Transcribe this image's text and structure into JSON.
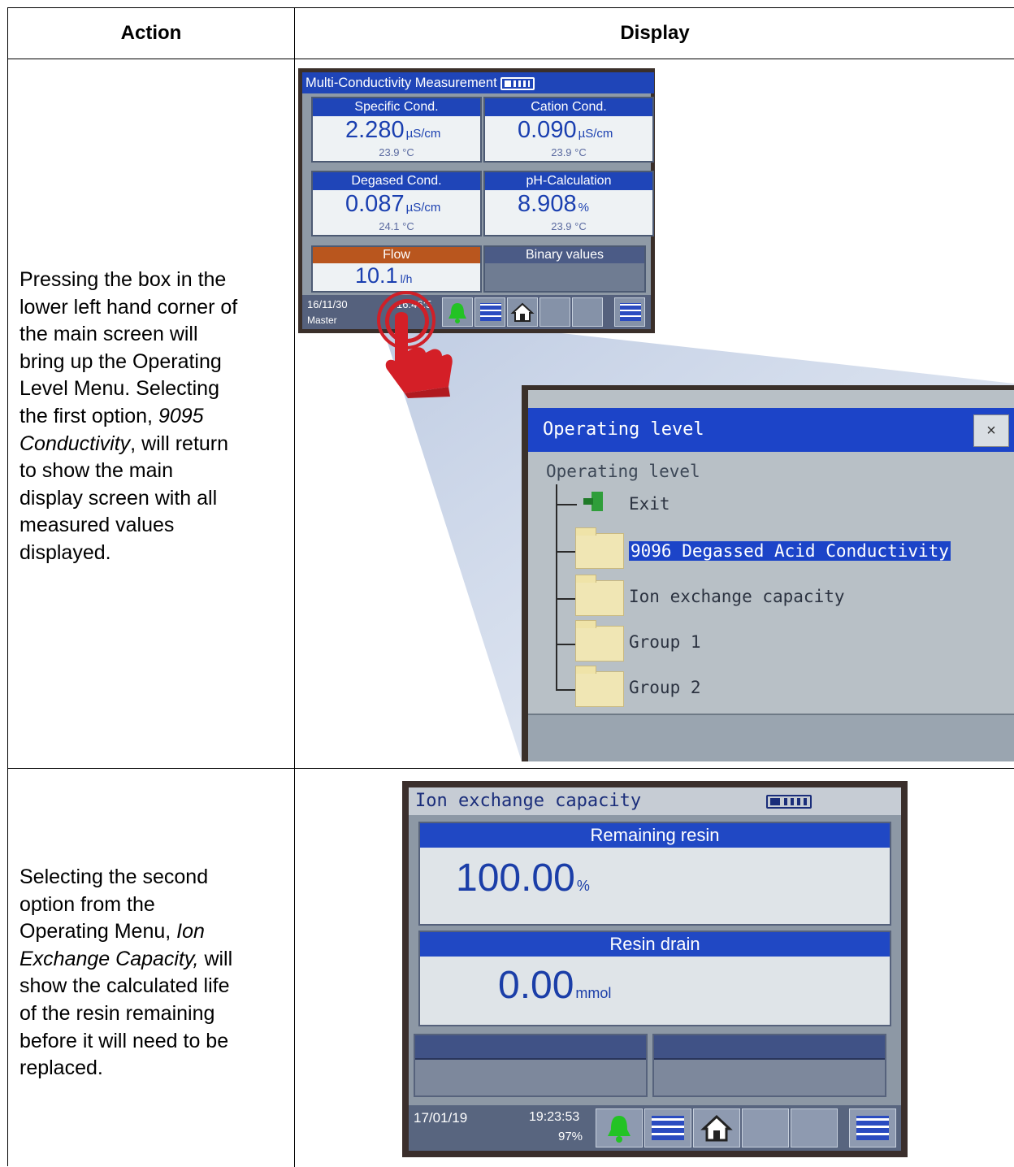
{
  "table": {
    "header_action": "Action",
    "header_display": "Display"
  },
  "row1": {
    "text_line1": "Pressing the box in the",
    "text_line2": "lower left hand corner of",
    "text_line3": "the main screen will",
    "text_line4": "bring up the Operating",
    "text_line5": "Level Menu. Selecting",
    "text_line6_prefix": "the first option, ",
    "text_line6_italic": "9095",
    "text_line7_italic": "Conductivity",
    "text_line7_suffix": ", will return",
    "text_line8": "to show the main",
    "text_line9": "display screen with all",
    "text_line10": "measured values",
    "text_line11": "displayed."
  },
  "screen1": {
    "title": "Multi-Conductivity Measurement",
    "cells": [
      {
        "header": "Specific Cond.",
        "value": "2.280",
        "unit": "µS/cm",
        "temp": "23.9 °C"
      },
      {
        "header": "Cation Cond.",
        "value": "0.090",
        "unit": "µS/cm",
        "temp": "23.9 °C"
      },
      {
        "header": "Degased Cond.",
        "value": "0.087",
        "unit": "µS/cm",
        "temp": "24.1 °C"
      },
      {
        "header": "pH-Calculation",
        "value": "8.908",
        "unit": "%",
        "temp": "23.9 °C"
      }
    ],
    "flow": {
      "header": "Flow",
      "value": "10.1",
      "unit": "l/h"
    },
    "binary": {
      "header": "Binary values"
    },
    "status": {
      "date": "16/11/30",
      "time": "16:46:5",
      "role": "Master"
    }
  },
  "dialog": {
    "title": "Operating level",
    "close": "×",
    "root": "Operating level",
    "items": [
      {
        "label": "Exit"
      },
      {
        "label": "9096 Degassed Acid Conductivity"
      },
      {
        "label": "Ion exchange capacity"
      },
      {
        "label": "Group 1"
      },
      {
        "label": "Group 2"
      }
    ]
  },
  "row2": {
    "text_line1": "Selecting the second",
    "text_line2": "option from the",
    "text_line3_prefix": "Operating Menu, ",
    "text_line3_italic": "Ion",
    "text_line4_italic": "Exchange Capacity,",
    "text_line4_suffix": " will",
    "text_line5": "show the calculated life",
    "text_line6": "of the resin remaining",
    "text_line7": "before it will need to be",
    "text_line8": "replaced."
  },
  "screen2": {
    "title": "Ion exchange capacity",
    "remaining": {
      "header": "Remaining resin",
      "value": "100.00",
      "unit": "%"
    },
    "drain": {
      "header": "Resin drain",
      "value": "0.00",
      "unit": "mmol"
    },
    "status": {
      "date": "17/01/19",
      "time": "19:23:53",
      "pct": "97%"
    }
  },
  "colors": {
    "screen_blue": "#1f45b8",
    "flow_orange": "#b9561e",
    "pointer_red": "#d02028",
    "bell_green": "#23c324"
  },
  "icons": [
    "hand-pointer-icon",
    "bell-icon",
    "grid-icon",
    "home-icon",
    "export-icon",
    "exit-door-icon",
    "folder-icon",
    "battery-icon",
    "close-icon"
  ]
}
